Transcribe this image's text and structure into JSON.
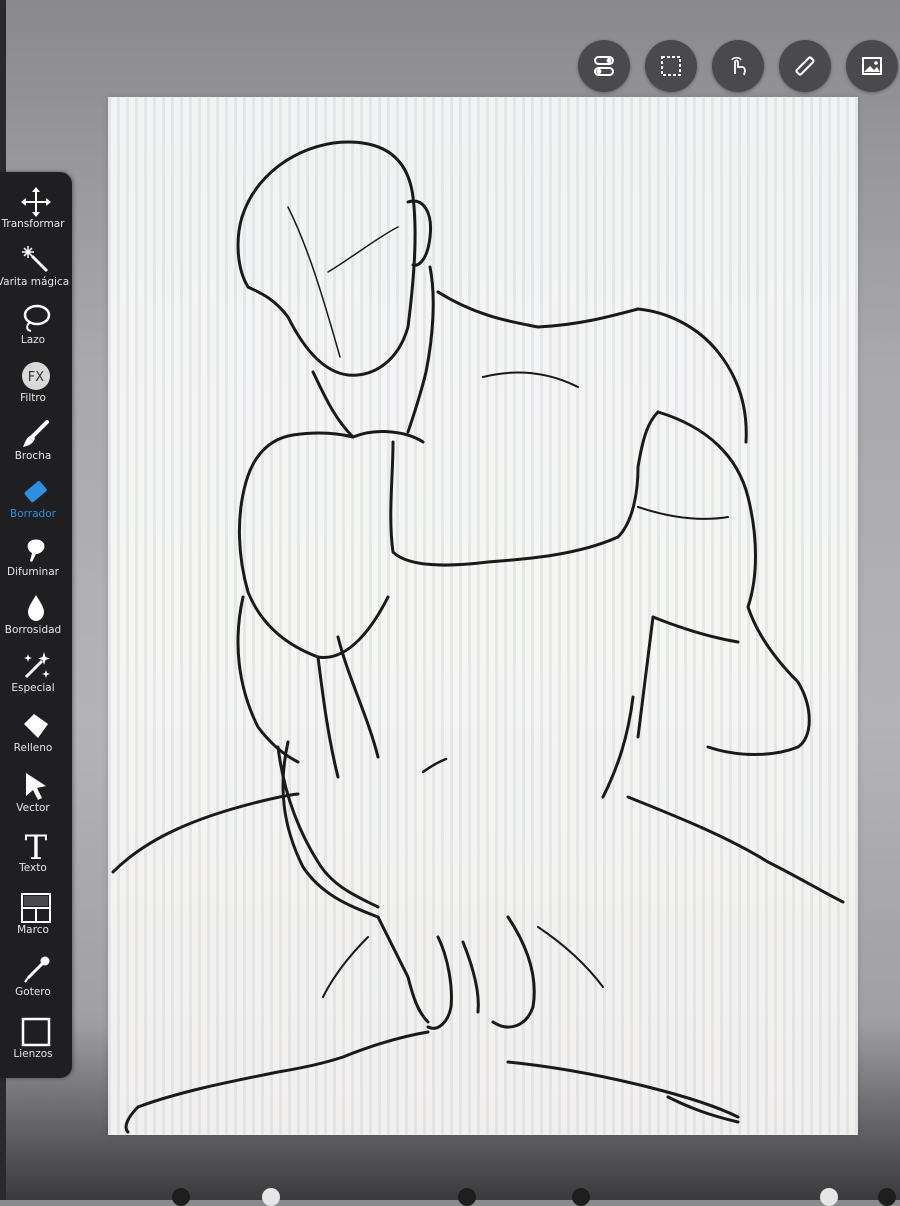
{
  "app": {
    "accent_color": "#2e8fe0",
    "toolbar_bg": "#1f1f21"
  },
  "toolbar": {
    "items": [
      {
        "label": "Transformar",
        "icon": "move-arrows-icon"
      },
      {
        "label": "Varita mágica",
        "icon": "magic-wand-icon"
      },
      {
        "label": "Lazo",
        "icon": "lasso-icon"
      },
      {
        "label": "Filtro",
        "icon": "fx-filter-icon"
      },
      {
        "label": "Brocha",
        "icon": "brush-icon"
      },
      {
        "label": "Borrador",
        "icon": "eraser-icon",
        "active": true
      },
      {
        "label": "Difuminar",
        "icon": "smudge-icon"
      },
      {
        "label": "Borrosidad",
        "icon": "blur-drop-icon"
      },
      {
        "label": "Especial",
        "icon": "sparkle-wand-icon"
      },
      {
        "label": "Relleno",
        "icon": "fill-bucket-icon"
      },
      {
        "label": "Vector",
        "icon": "vector-cursor-icon"
      },
      {
        "label": "Texto",
        "icon": "text-t-icon"
      },
      {
        "label": "Marco",
        "icon": "frame-panels-icon"
      },
      {
        "label": "Gotero",
        "icon": "eyedropper-icon"
      },
      {
        "label": "Lienzos",
        "icon": "canvas-square-icon"
      }
    ],
    "fx_glyph": "FX",
    "text_glyph": "T"
  },
  "top_actions": [
    {
      "icon": "toggle-switches-icon"
    },
    {
      "icon": "selection-marquee-icon"
    },
    {
      "icon": "touch-gesture-icon"
    },
    {
      "icon": "ruler-icon"
    },
    {
      "icon": "image-gallery-icon"
    }
  ]
}
